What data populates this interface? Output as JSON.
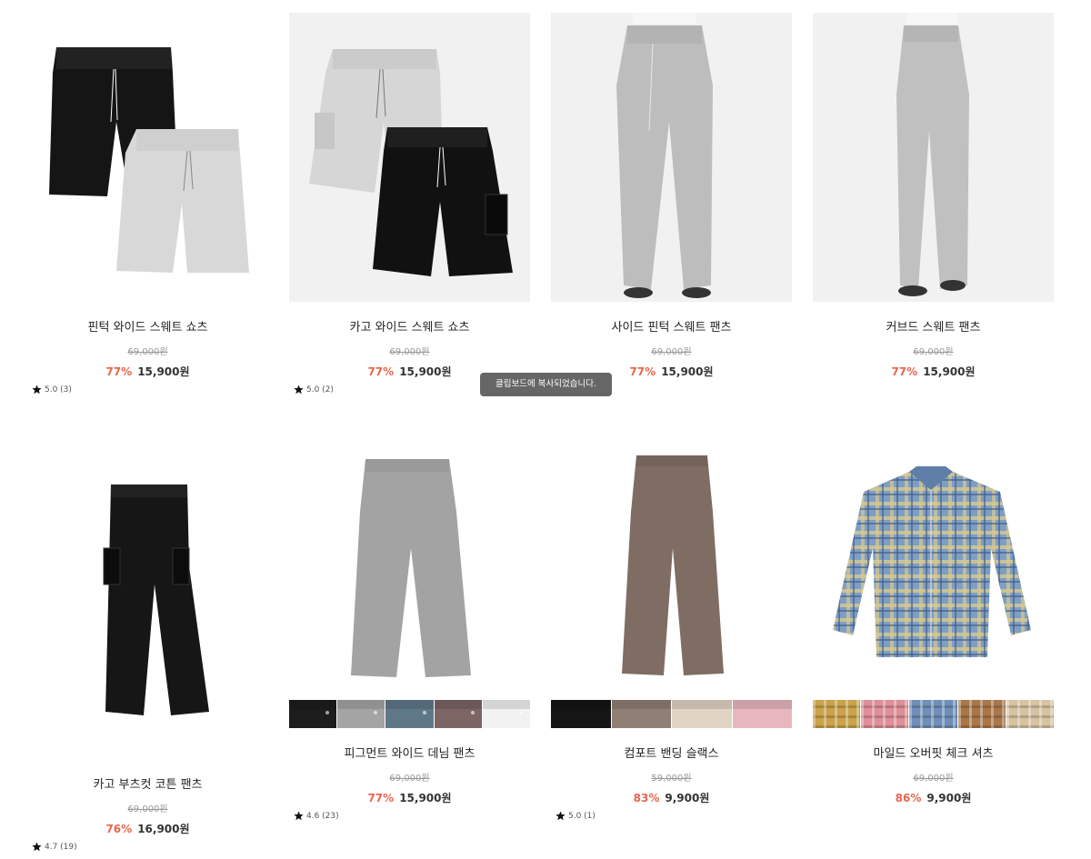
{
  "products": [
    {
      "name": "핀턱 와이드 스웨트 쇼츠",
      "original_price": "69,000원",
      "discount": "77%",
      "price": "15,900원",
      "rating": "5.0 (3)"
    },
    {
      "name": "카고 와이드 스웨트 쇼츠",
      "original_price": "69,000원",
      "discount": "77%",
      "price": "15,900원",
      "rating": "5.0 (2)"
    },
    {
      "name": "사이드 핀턱 스웨트 팬츠",
      "original_price": "69,000원",
      "discount": "77%",
      "price": "15,900원",
      "rating": ""
    },
    {
      "name": "커브드 스웨트 팬츠",
      "original_price": "69,000원",
      "discount": "77%",
      "price": "15,900원",
      "rating": ""
    },
    {
      "name": "카고 부츠컷 코튼 팬츠",
      "original_price": "69,000원",
      "discount": "76%",
      "price": "16,900원",
      "rating": "4.7 (19)"
    },
    {
      "name": "피그먼트 와이드 데님 팬츠",
      "original_price": "69,000원",
      "discount": "77%",
      "price": "15,900원",
      "rating": "4.6 (23)"
    },
    {
      "name": "컴포트 밴딩 슬랙스",
      "original_price": "59,000원",
      "discount": "83%",
      "price": "9,900원",
      "rating": "5.0 (1)"
    },
    {
      "name": "마일드 오버핏 체크 셔츠",
      "original_price": "69,000원",
      "discount": "86%",
      "price": "9,900원",
      "rating": ""
    }
  ],
  "toast": {
    "message": "클립보드에 복사되었습니다."
  },
  "colors": {
    "discount": "#e8664f",
    "toast_bg": "#666666"
  },
  "swatches": {
    "denim": [
      "#1d1d1d",
      "#a4a4a4",
      "#5f7888",
      "#7d6566",
      "#f2f2f2"
    ],
    "slacks": [
      "#151515",
      "#8f7f74",
      "#e1d4c4",
      "#e8b7bd"
    ],
    "shirt": [
      "#c9a24a",
      "#de8f98",
      "#6f8fb8",
      "#a9774a",
      "#d7c3a0"
    ]
  }
}
